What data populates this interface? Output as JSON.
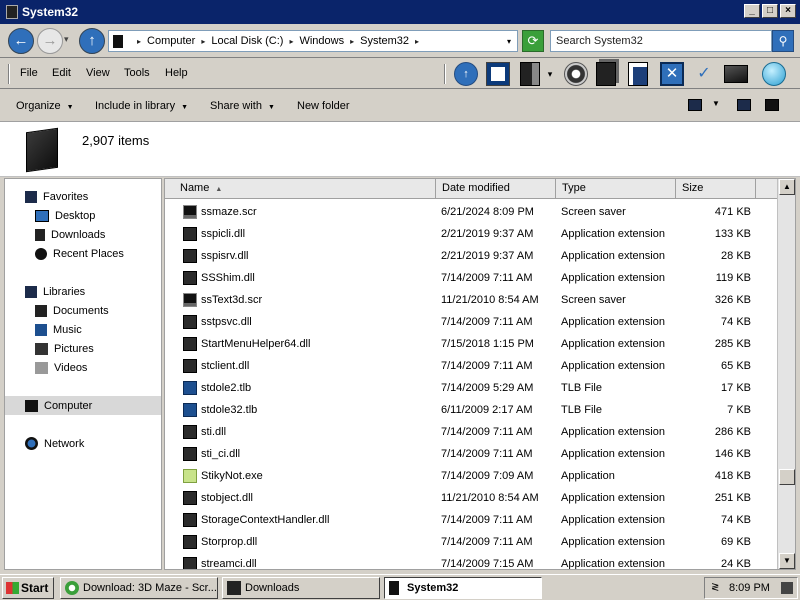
{
  "window": {
    "title": "System32",
    "minimize": "_",
    "maximize": "□",
    "close": "×"
  },
  "nav": {
    "back_glyph": "←",
    "forward_glyph": "→",
    "up_glyph": "↑",
    "history_glyph": "▾"
  },
  "address": {
    "crumbs": [
      "Computer",
      "Local Disk (C:)",
      "Windows",
      "System32"
    ],
    "separator": "▸",
    "dropdown_glyph": "▾",
    "refresh_glyph": "⟳"
  },
  "search": {
    "placeholder": "Search System32",
    "button_glyph": "⚲"
  },
  "menu": {
    "file": "File",
    "edit": "Edit",
    "view": "View",
    "tools": "Tools",
    "help": "Help"
  },
  "toolbar_icons": [
    "up-arrow-icon",
    "monitor-icon",
    "copy-icon",
    "drop-arrow-icon",
    "network-icon",
    "pages-icon",
    "document-icon",
    "close-x-icon",
    "checkmark-icon",
    "folder-icon",
    "shell-icon"
  ],
  "toolbar": {
    "check_glyph": "✓",
    "x_glyph": "✕",
    "drop_glyph": "▾"
  },
  "commands": {
    "organize": "Organize",
    "include_in_library": "Include in library",
    "share_with": "Share with",
    "new_folder": "New folder",
    "arrow": "▼"
  },
  "info": {
    "item_count": "2,907 items"
  },
  "navpane": {
    "favorites": "Favorites",
    "desktop": "Desktop",
    "downloads": "Downloads",
    "recent_places": "Recent Places",
    "libraries": "Libraries",
    "documents": "Documents",
    "music": "Music",
    "pictures": "Pictures",
    "videos": "Videos",
    "computer": "Computer",
    "network": "Network"
  },
  "columns": {
    "name": "Name",
    "date_modified": "Date modified",
    "type": "Type",
    "size": "Size",
    "sort_glyph": "▲"
  },
  "files": [
    {
      "name": "ssmaze.scr",
      "date": "6/21/2024 8:09 PM",
      "type": "Screen saver",
      "size": "471 KB",
      "kind": "scr"
    },
    {
      "name": "sspicli.dll",
      "date": "2/21/2019 9:37 AM",
      "type": "Application extension",
      "size": "133 KB",
      "kind": "dll"
    },
    {
      "name": "sspisrv.dll",
      "date": "2/21/2019 9:37 AM",
      "type": "Application extension",
      "size": "28 KB",
      "kind": "dll"
    },
    {
      "name": "SSShim.dll",
      "date": "7/14/2009 7:11 AM",
      "type": "Application extension",
      "size": "119 KB",
      "kind": "dll"
    },
    {
      "name": "ssText3d.scr",
      "date": "11/21/2010 8:54 AM",
      "type": "Screen saver",
      "size": "326 KB",
      "kind": "scr"
    },
    {
      "name": "sstpsvc.dll",
      "date": "7/14/2009 7:11 AM",
      "type": "Application extension",
      "size": "74 KB",
      "kind": "dll"
    },
    {
      "name": "StartMenuHelper64.dll",
      "date": "7/15/2018 1:15 PM",
      "type": "Application extension",
      "size": "285 KB",
      "kind": "dll"
    },
    {
      "name": "stclient.dll",
      "date": "7/14/2009 7:11 AM",
      "type": "Application extension",
      "size": "65 KB",
      "kind": "dll"
    },
    {
      "name": "stdole2.tlb",
      "date": "7/14/2009 5:29 AM",
      "type": "TLB File",
      "size": "17 KB",
      "kind": "tlb"
    },
    {
      "name": "stdole32.tlb",
      "date": "6/11/2009 2:17 AM",
      "type": "TLB File",
      "size": "7 KB",
      "kind": "tlb"
    },
    {
      "name": "sti.dll",
      "date": "7/14/2009 7:11 AM",
      "type": "Application extension",
      "size": "286 KB",
      "kind": "dll"
    },
    {
      "name": "sti_ci.dll",
      "date": "7/14/2009 7:11 AM",
      "type": "Application extension",
      "size": "146 KB",
      "kind": "dll"
    },
    {
      "name": "StikyNot.exe",
      "date": "7/14/2009 7:09 AM",
      "type": "Application",
      "size": "418 KB",
      "kind": "exe"
    },
    {
      "name": "stobject.dll",
      "date": "11/21/2010 8:54 AM",
      "type": "Application extension",
      "size": "251 KB",
      "kind": "dll"
    },
    {
      "name": "StorageContextHandler.dll",
      "date": "7/14/2009 7:11 AM",
      "type": "Application extension",
      "size": "74 KB",
      "kind": "dll"
    },
    {
      "name": "Storprop.dll",
      "date": "7/14/2009 7:11 AM",
      "type": "Application extension",
      "size": "69 KB",
      "kind": "dll"
    },
    {
      "name": "streamci.dll",
      "date": "7/14/2009 7:15 AM",
      "type": "Application extension",
      "size": "24 KB",
      "kind": "dll"
    }
  ],
  "scroll": {
    "up_glyph": "▲",
    "down_glyph": "▼"
  },
  "taskbar": {
    "start": "Start",
    "tasks": [
      {
        "label": "Download: 3D Maze - Scr...",
        "active": false
      },
      {
        "label": "Downloads",
        "active": false
      },
      {
        "label": "System32",
        "active": true
      }
    ],
    "tray_chevron": "≷",
    "clock": "8:09 PM"
  }
}
